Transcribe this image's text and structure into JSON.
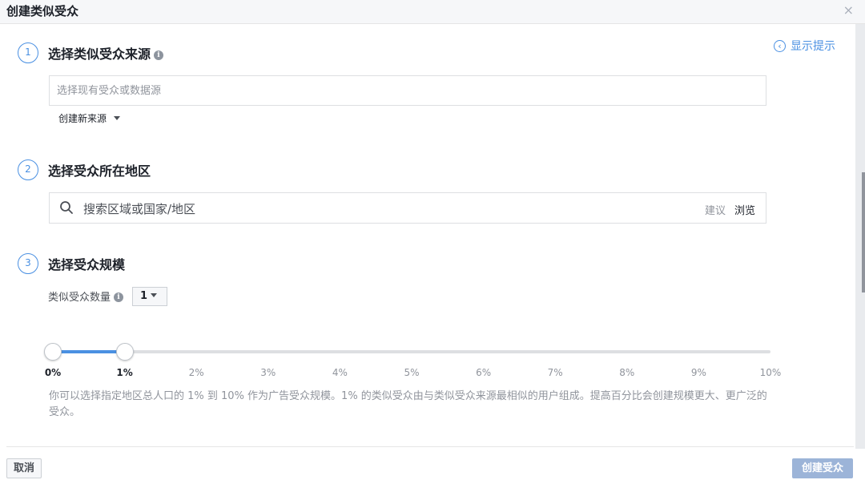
{
  "dialog": {
    "title": "创建类似受众",
    "close_symbol": "×"
  },
  "hint": {
    "label": "显示提示"
  },
  "step1": {
    "number": "1",
    "title": "选择类似受众来源",
    "info_icon": "i",
    "source_placeholder": "选择现有受众或数据源",
    "source_value": "",
    "create_source_label": "创建新来源"
  },
  "step2": {
    "number": "2",
    "title": "选择受众所在地区",
    "location_placeholder": "搜索区域或国家/地区",
    "location_value": "",
    "suggest_label": "建议",
    "browse_label": "浏览"
  },
  "step3": {
    "number": "3",
    "title": "选择受众规模",
    "count_label": "类似受众数量",
    "count_value": "1",
    "slider": {
      "ticks": [
        "0%",
        "1%",
        "2%",
        "3%",
        "4%",
        "5%",
        "6%",
        "7%",
        "8%",
        "9%",
        "10%"
      ],
      "range_start_percent": 0,
      "range_end_percent": 1
    },
    "description": "你可以选择指定地区总人口的 1% 到 10% 作为广告受众规模。1% 的类似受众由与类似受众来源最相似的用户组成。提高百分比会创建规模更大、更广泛的受众。"
  },
  "footer": {
    "cancel_label": "取消",
    "create_label": "创建受众"
  },
  "colors": {
    "accent": "#4a90e2",
    "disabled_button": "#9cb4d8",
    "muted_text": "#90949c"
  },
  "icons": {
    "hint": "chevron-left-circle-icon",
    "search": "search-icon",
    "close": "close-icon",
    "info": "info-icon",
    "dropdown": "caret-down-icon"
  }
}
